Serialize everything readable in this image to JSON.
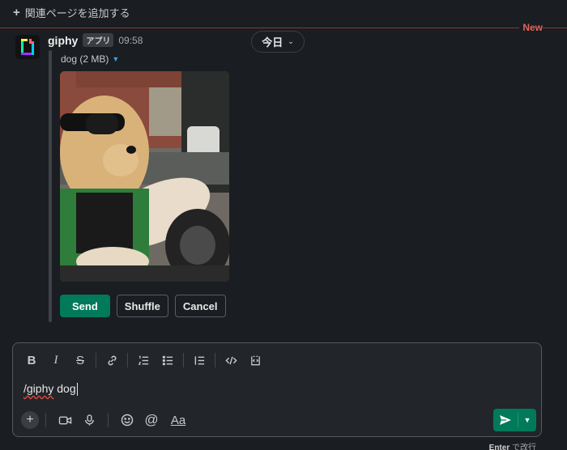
{
  "top": {
    "add_related_label": "関連ページを追加する",
    "new_label": "New"
  },
  "date_divider": {
    "label": "今日"
  },
  "message": {
    "sender": "giphy",
    "badge": "アプリ",
    "time": "09:58",
    "file_name": "dog (2 MB)",
    "actions": {
      "send": "Send",
      "shuffle": "Shuffle",
      "cancel": "Cancel"
    }
  },
  "composer": {
    "command": "/giphy",
    "argument": "dog",
    "hint_key": "Enter",
    "hint_text": "で改行"
  },
  "colors": {
    "accent_green": "#007a5a",
    "new_red": "#e0655a",
    "link_blue": "#36a2e8"
  }
}
